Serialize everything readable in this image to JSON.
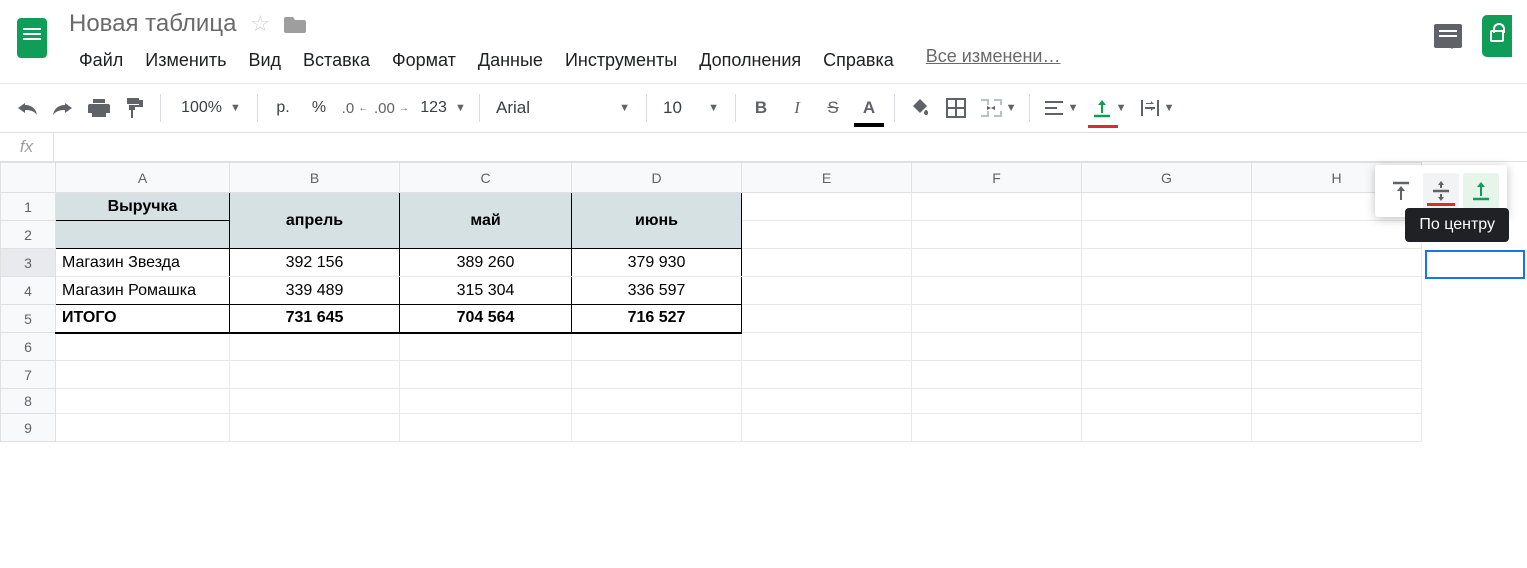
{
  "doc_title": "Новая таблица",
  "menu": [
    "Файл",
    "Изменить",
    "Вид",
    "Вставка",
    "Формат",
    "Данные",
    "Инструменты",
    "Дополнения",
    "Справка"
  ],
  "changes_link": "Все изменени…",
  "toolbar": {
    "zoom": "100%",
    "currency": "р.",
    "percent": "%",
    "dec_less": ".0",
    "dec_more": ".00",
    "numfmt": "123",
    "font": "Arial",
    "fontsize": "10"
  },
  "formula_fx": "fx",
  "formula_value": "",
  "columns": [
    "A",
    "B",
    "C",
    "D",
    "E",
    "F",
    "G",
    "H"
  ],
  "rows": [
    "1",
    "2",
    "3",
    "4",
    "5",
    "6",
    "7",
    "8",
    "9"
  ],
  "table": {
    "title": "Выручка",
    "months": [
      "апрель",
      "май",
      "июнь"
    ],
    "rows": [
      {
        "label": "Магазин Звезда",
        "vals": [
          "392 156",
          "389 260",
          "379 930"
        ]
      },
      {
        "label": "Магазин Ромашка",
        "vals": [
          "339 489",
          "315 304",
          "336 597"
        ]
      }
    ],
    "total_label": "ИТОГО",
    "totals": [
      "731 645",
      "704 564",
      "716 527"
    ]
  },
  "tooltip": "По центру",
  "chart_data": {
    "type": "table",
    "title": "Выручка",
    "columns": [
      "",
      "апрель",
      "май",
      "июнь"
    ],
    "rows": [
      [
        "Магазин Звезда",
        392156,
        389260,
        379930
      ],
      [
        "Магазин Ромашка",
        339489,
        315304,
        336597
      ],
      [
        "ИТОГО",
        731645,
        704564,
        716527
      ]
    ]
  }
}
